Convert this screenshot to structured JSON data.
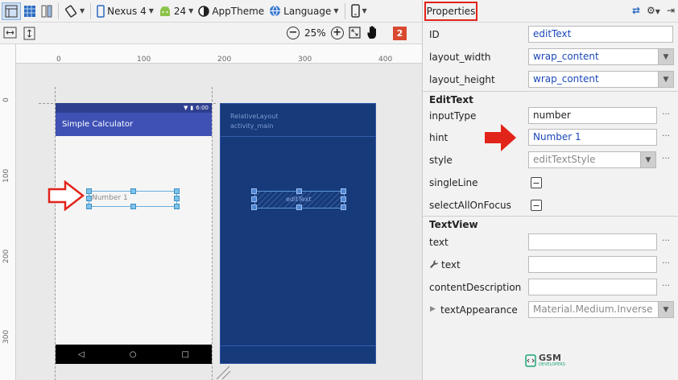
{
  "toolbar": {
    "device": "Nexus 4",
    "api_level": "24",
    "theme": "AppTheme",
    "language": "Language"
  },
  "toolbar2": {
    "zoom_level": "25%",
    "warning_count": "2"
  },
  "ruler": {
    "top_ticks": [
      "0",
      "100",
      "200",
      "300",
      "400"
    ],
    "left_ticks": [
      "0",
      "100",
      "200",
      "300"
    ]
  },
  "design_preview": {
    "status_time": "6:00",
    "app_title": "Simple Calculator",
    "edittext_hint": "Number 1"
  },
  "blueprint": {
    "layout_type": "RelativeLayout",
    "layout_id": "activity_main",
    "widget_label": "editText"
  },
  "properties": {
    "title": "Properties",
    "id_label": "ID",
    "id_value": "editText",
    "layout_width_label": "layout_width",
    "layout_width_value": "wrap_content",
    "layout_height_label": "layout_height",
    "layout_height_value": "wrap_content",
    "edittext_section": "EditText",
    "input_type_label": "inputType",
    "input_type_value": "number",
    "hint_label": "hint",
    "hint_value": "Number 1",
    "style_label": "style",
    "style_value": "editTextStyle",
    "single_line_label": "singleLine",
    "select_all_label": "selectAllOnFocus",
    "textview_section": "TextView",
    "text_label": "text",
    "text_value": "",
    "tools_text_label": "text",
    "tools_text_value": "",
    "content_description_label": "contentDescription",
    "content_description_value": "",
    "text_appearance_label": "textAppearance",
    "text_appearance_value": "Material.Medium.Inverse"
  },
  "watermark": {
    "brand": "GSM",
    "sub": "DEVELOPERS"
  },
  "colors": {
    "blueprint_bg": "#163a7a",
    "action_bar": "#3f51b5",
    "highlight_red": "#e2231a"
  }
}
